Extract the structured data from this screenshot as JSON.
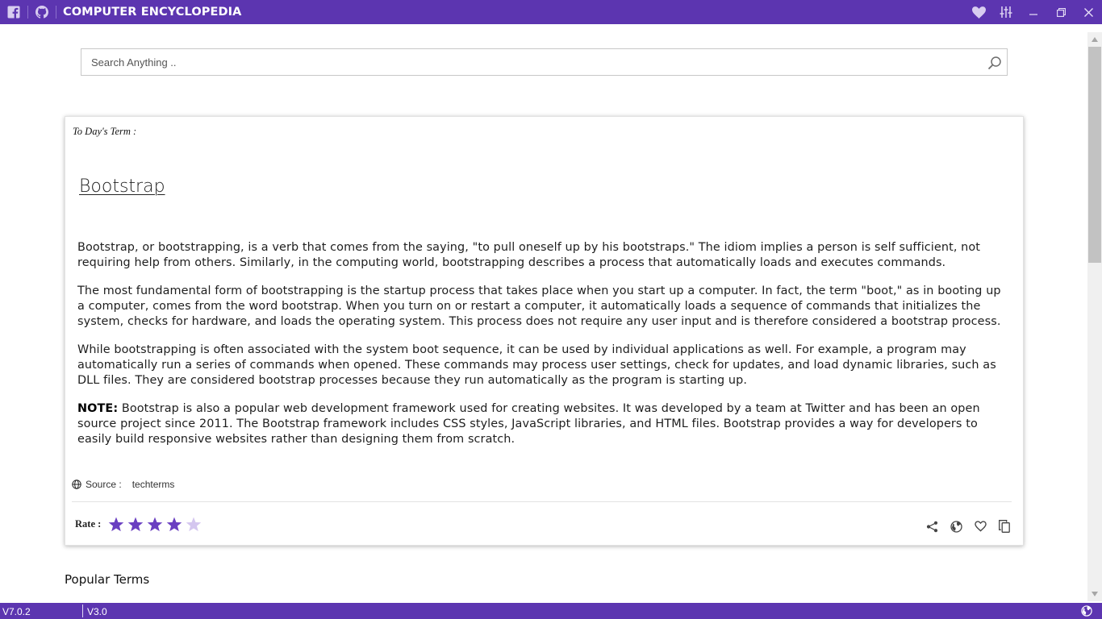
{
  "app": {
    "title": "COMPUTER ENCYCLOPEDIA",
    "accent_color": "#5c35b0"
  },
  "titlebar": {
    "left_icons": [
      "facebook-icon",
      "github-icon"
    ],
    "right_icons": [
      "heart-icon",
      "equalizer-icon",
      "minimize-icon",
      "restore-icon",
      "close-icon"
    ]
  },
  "search": {
    "placeholder": "Search Anything ..",
    "value": ""
  },
  "card": {
    "term_label": "To Day's Term :",
    "term_title": "Bootstrap",
    "paragraphs": [
      "Bootstrap, or bootstrapping, is a verb that comes from the saying, \"to pull oneself up by his bootstraps.\" The idiom implies a person is self sufficient, not requiring help from others. Similarly, in the computing world, bootstrapping describes a process that automatically loads and executes commands.",
      "The most fundamental form of bootstrapping is the startup process that takes place when you start up a computer. In fact, the term \"boot,\" as in booting up a computer, comes from the word bootstrap. When you turn on or restart a computer, it automatically loads a sequence of commands that initializes the system, checks for hardware, and loads the operating system. This process does not require any user input and is therefore considered a bootstrap process.",
      "While bootstrapping is often associated with the system boot sequence, it can be used by individual applications as well. For example, a program may automatically run a series of commands when opened. These commands may process user settings, check for updates, and load dynamic libraries, such as DLL files. They are considered bootstrap processes because they run automatically as the program is starting up."
    ],
    "note_label": "NOTE:",
    "note_text": " Bootstrap is also a popular web development framework used for creating websites. It was developed by a team at Twitter and has been an open source project since 2011. The Bootstrap framework includes CSS styles, JavaScript libraries, and HTML files. Bootstrap provides a way for developers to easily build responsive websites rather than designing them from scratch.",
    "source_label": "Source :",
    "source_value": "techterms",
    "rate_label": "Rate :",
    "rating": 4,
    "rating_max": 5,
    "star_color": "#6a3fc1",
    "star_empty_color": "#d4c6ef",
    "action_icons": [
      "share-icon",
      "globe-icon",
      "heart-outline-icon",
      "copy-icon"
    ]
  },
  "popular_heading": "Popular Terms",
  "statusbar": {
    "version_left": "V7.0.2",
    "version_right": "V3.0"
  }
}
